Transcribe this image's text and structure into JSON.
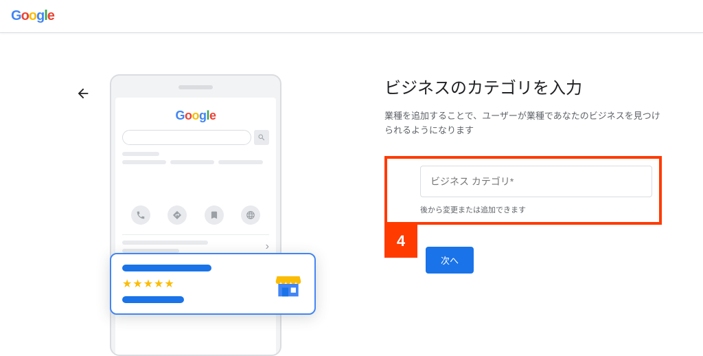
{
  "header": {
    "logo": {
      "g1": "G",
      "o1": "o",
      "o2": "o",
      "g2": "g",
      "l": "l",
      "e": "e"
    }
  },
  "phone": {
    "logo": {
      "g1": "G",
      "o1": "o",
      "o2": "o",
      "g2": "g",
      "l": "l",
      "e": "e"
    },
    "stars": "★★★★★"
  },
  "main": {
    "title": "ビジネスのカテゴリを入力",
    "description": "業種を追加することで、ユーザーが業種であなたのビジネスを見つけられるようになります",
    "input_placeholder": "ビジネス カテゴリ*",
    "helper": "後から変更または追加できます",
    "next_label": "次へ",
    "step_number": "4"
  }
}
